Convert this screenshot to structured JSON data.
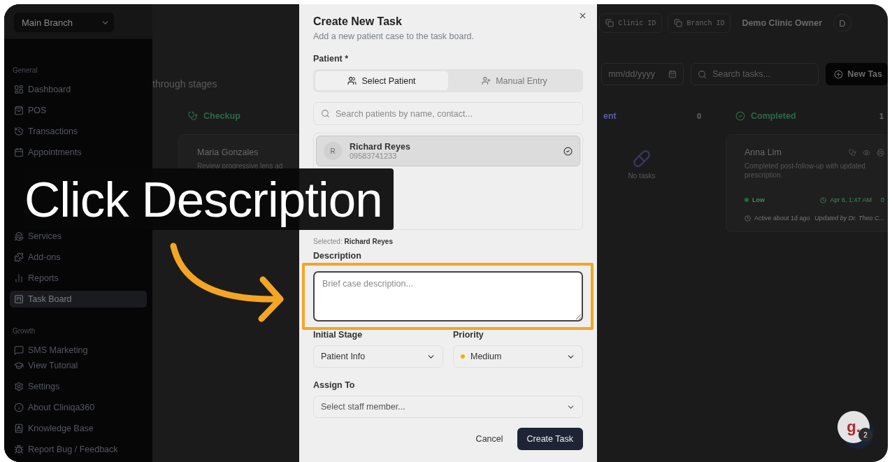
{
  "branch_select": {
    "value": "Main Branch"
  },
  "sidebar": {
    "sections": [
      {
        "title": "General",
        "items": [
          {
            "label": "Dashboard",
            "selected": false
          },
          {
            "label": "POS",
            "selected": false
          },
          {
            "label": "Transactions",
            "selected": false
          },
          {
            "label": "Appointments",
            "selected": false
          },
          {
            "label": "Services",
            "selected": false
          },
          {
            "label": "Add-ons",
            "selected": false
          },
          {
            "label": "Reports",
            "selected": false
          },
          {
            "label": "Task Board",
            "selected": true
          }
        ]
      },
      {
        "title": "Growth",
        "items": [
          {
            "label": "SMS Marketing",
            "selected": false
          }
        ]
      }
    ],
    "footer_items": [
      "View Tutorial",
      "Settings",
      "About Cliniqa360",
      "Knowledge Base",
      "Report Bug / Feedback"
    ]
  },
  "topbar": {
    "clinic_id": "Clinic ID",
    "branch_id": "Branch ID",
    "user_name": "Demo Clinic Owner",
    "avatar": "D"
  },
  "board": {
    "subtitle": "through stages",
    "date_field": {
      "placeholder": "mm/dd/yyyy"
    },
    "search": {
      "placeholder": "Search tasks..."
    },
    "new_button": "New Tas",
    "columns": [
      {
        "title": "Checkup",
        "cards": [
          {
            "name": "Maria Gonzales",
            "description": "Review progressive lens ad"
          }
        ]
      },
      {
        "title": "ent",
        "count": "0",
        "empty_text": "No tasks"
      },
      {
        "title": "Completed",
        "count": "1",
        "cards": [
          {
            "name": "Anna Lim",
            "description": "Completed post-follow-up with updated prescription.",
            "priority": {
              "label": "Low",
              "color": "#1d6b3c"
            },
            "date": "Apr 6, 1:47 AM",
            "comments": "0",
            "activity": "Active about 1d ago",
            "updated_by": "Updated by Dr. Theo C..."
          }
        ]
      }
    ]
  },
  "modal": {
    "title": "Create New Task",
    "subtitle": "Add a new patient case to the task board.",
    "patient_label": "Patient *",
    "tabs": [
      {
        "label": "Select Patient",
        "selected": true
      },
      {
        "label": "Manual Entry",
        "selected": false
      }
    ],
    "patient_search": {
      "placeholder": "Search patients by name, contact..."
    },
    "patients": [
      {
        "initial": "R",
        "name": "Richard Reyes",
        "phone": "09583741233",
        "selected": true
      }
    ],
    "selected_text": "Selected: **Richard Reyes**",
    "description": {
      "label": "Description",
      "placeholder": "Brief case description..."
    },
    "stage": {
      "label": "Initial Stage",
      "value": "Patient Info"
    },
    "priority": {
      "label": "Priority",
      "value": "Medium",
      "color": "#eab308"
    },
    "assign": {
      "label": "Assign To",
      "placeholder": "Select staff member..."
    },
    "buttons": {
      "cancel": "Cancel",
      "create": "Create Task"
    }
  },
  "tutorial": {
    "caption": "Click Description"
  },
  "chat": {
    "logo": "g.",
    "badge": "2"
  }
}
